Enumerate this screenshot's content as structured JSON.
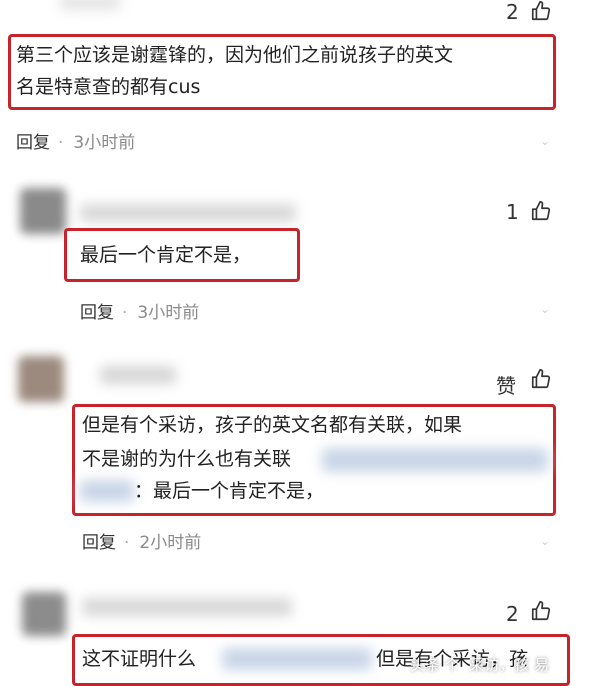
{
  "comments": [
    {
      "likes": "2",
      "text_lines": [
        "第三个应该是谢霆锋的，因为他们之前说孩子的英文",
        "名是特意查的都有cus"
      ],
      "reply_label": "回复",
      "time": "3小时前"
    },
    {
      "likes": "1",
      "text_lines": [
        "最后一个肯定不是，"
      ],
      "reply_label": "回复",
      "time": "3小时前"
    },
    {
      "likes": "赞",
      "text_lines": [
        "但是有个采访，孩子的英文名都有关联，如果",
        "不是谢的为什么也有关联",
        "：最后一个肯定不是，"
      ],
      "reply_label": "回复",
      "time": "2小时前"
    },
    {
      "likes": "2",
      "text_lines": [
        "这不证明什么",
        "但是有个采访，孩"
      ]
    }
  ],
  "watermark": "头条 个  采访，孩 易"
}
